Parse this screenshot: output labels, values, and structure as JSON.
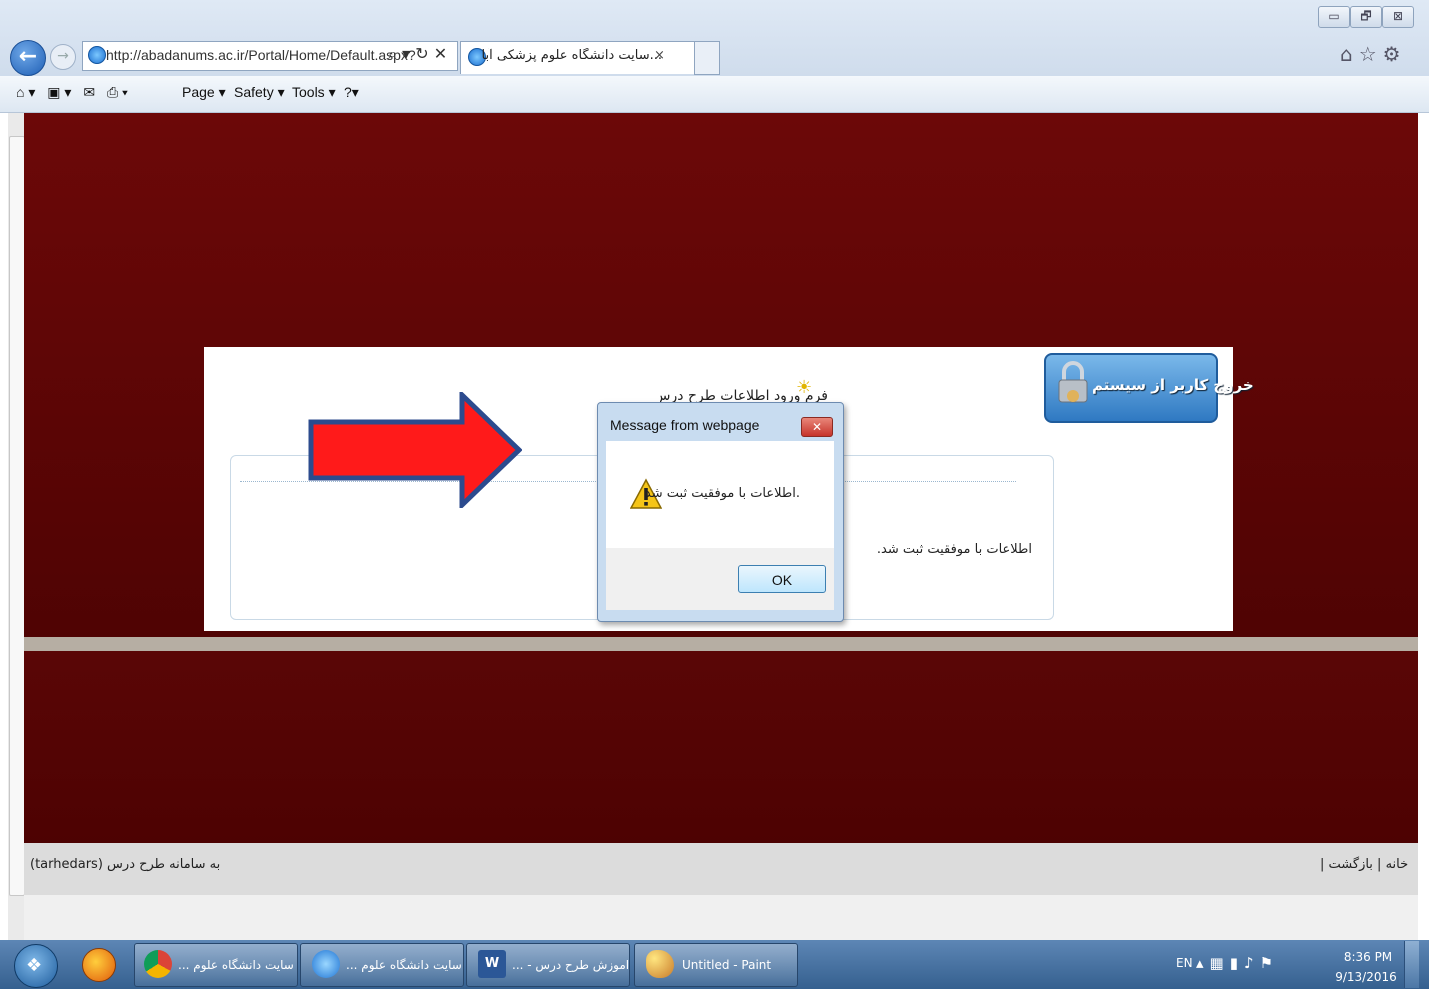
{
  "browser": {
    "url": "http://abadanums.ac.ir/Portal/Home/Default.aspx?",
    "tab_title": "...سایت دانشگاه علوم پزشکی آباد",
    "tab_close": "×",
    "window_controls": {
      "minimize": "▭",
      "restore": "🗗",
      "close": "⊠"
    },
    "toolbar_icons": [
      "home-icon",
      "star-icon",
      "gear-icon"
    ],
    "command_bar": {
      "page": "Page ▾",
      "safety": "Safety ▾",
      "tools": "Tools ▾",
      "help": "?▾"
    }
  },
  "page": {
    "form_title": "فرم ورود اطلاعات طرح درس",
    "success_message": "اطلاعات با موفقیت ثبت شد.",
    "logout_label": "خروج کاربر از سیستم",
    "footer_left": "به سامانه طرح درس (tarhedars)",
    "footer_right": "خانه | بازگشت |"
  },
  "dialog": {
    "title": "Message from webpage",
    "message": ".اطلاعات با موفقیت ثبت شد",
    "ok_label": "OK",
    "close": "✕"
  },
  "taskbar": {
    "items": [
      {
        "label": "... سایت دانشگاه علوم"
      },
      {
        "label": "... سایت دانشگاه علوم"
      },
      {
        "label": "... - اموزش طرح درس"
      },
      {
        "label": "Untitled - Paint"
      }
    ],
    "lang": "EN",
    "time": "8:36 PM",
    "date": "9/13/2016"
  },
  "colors": {
    "page_bg": "#6c0808",
    "accent_arrow": "#ff1a1a",
    "arrow_outline": "#2c4b8e"
  }
}
